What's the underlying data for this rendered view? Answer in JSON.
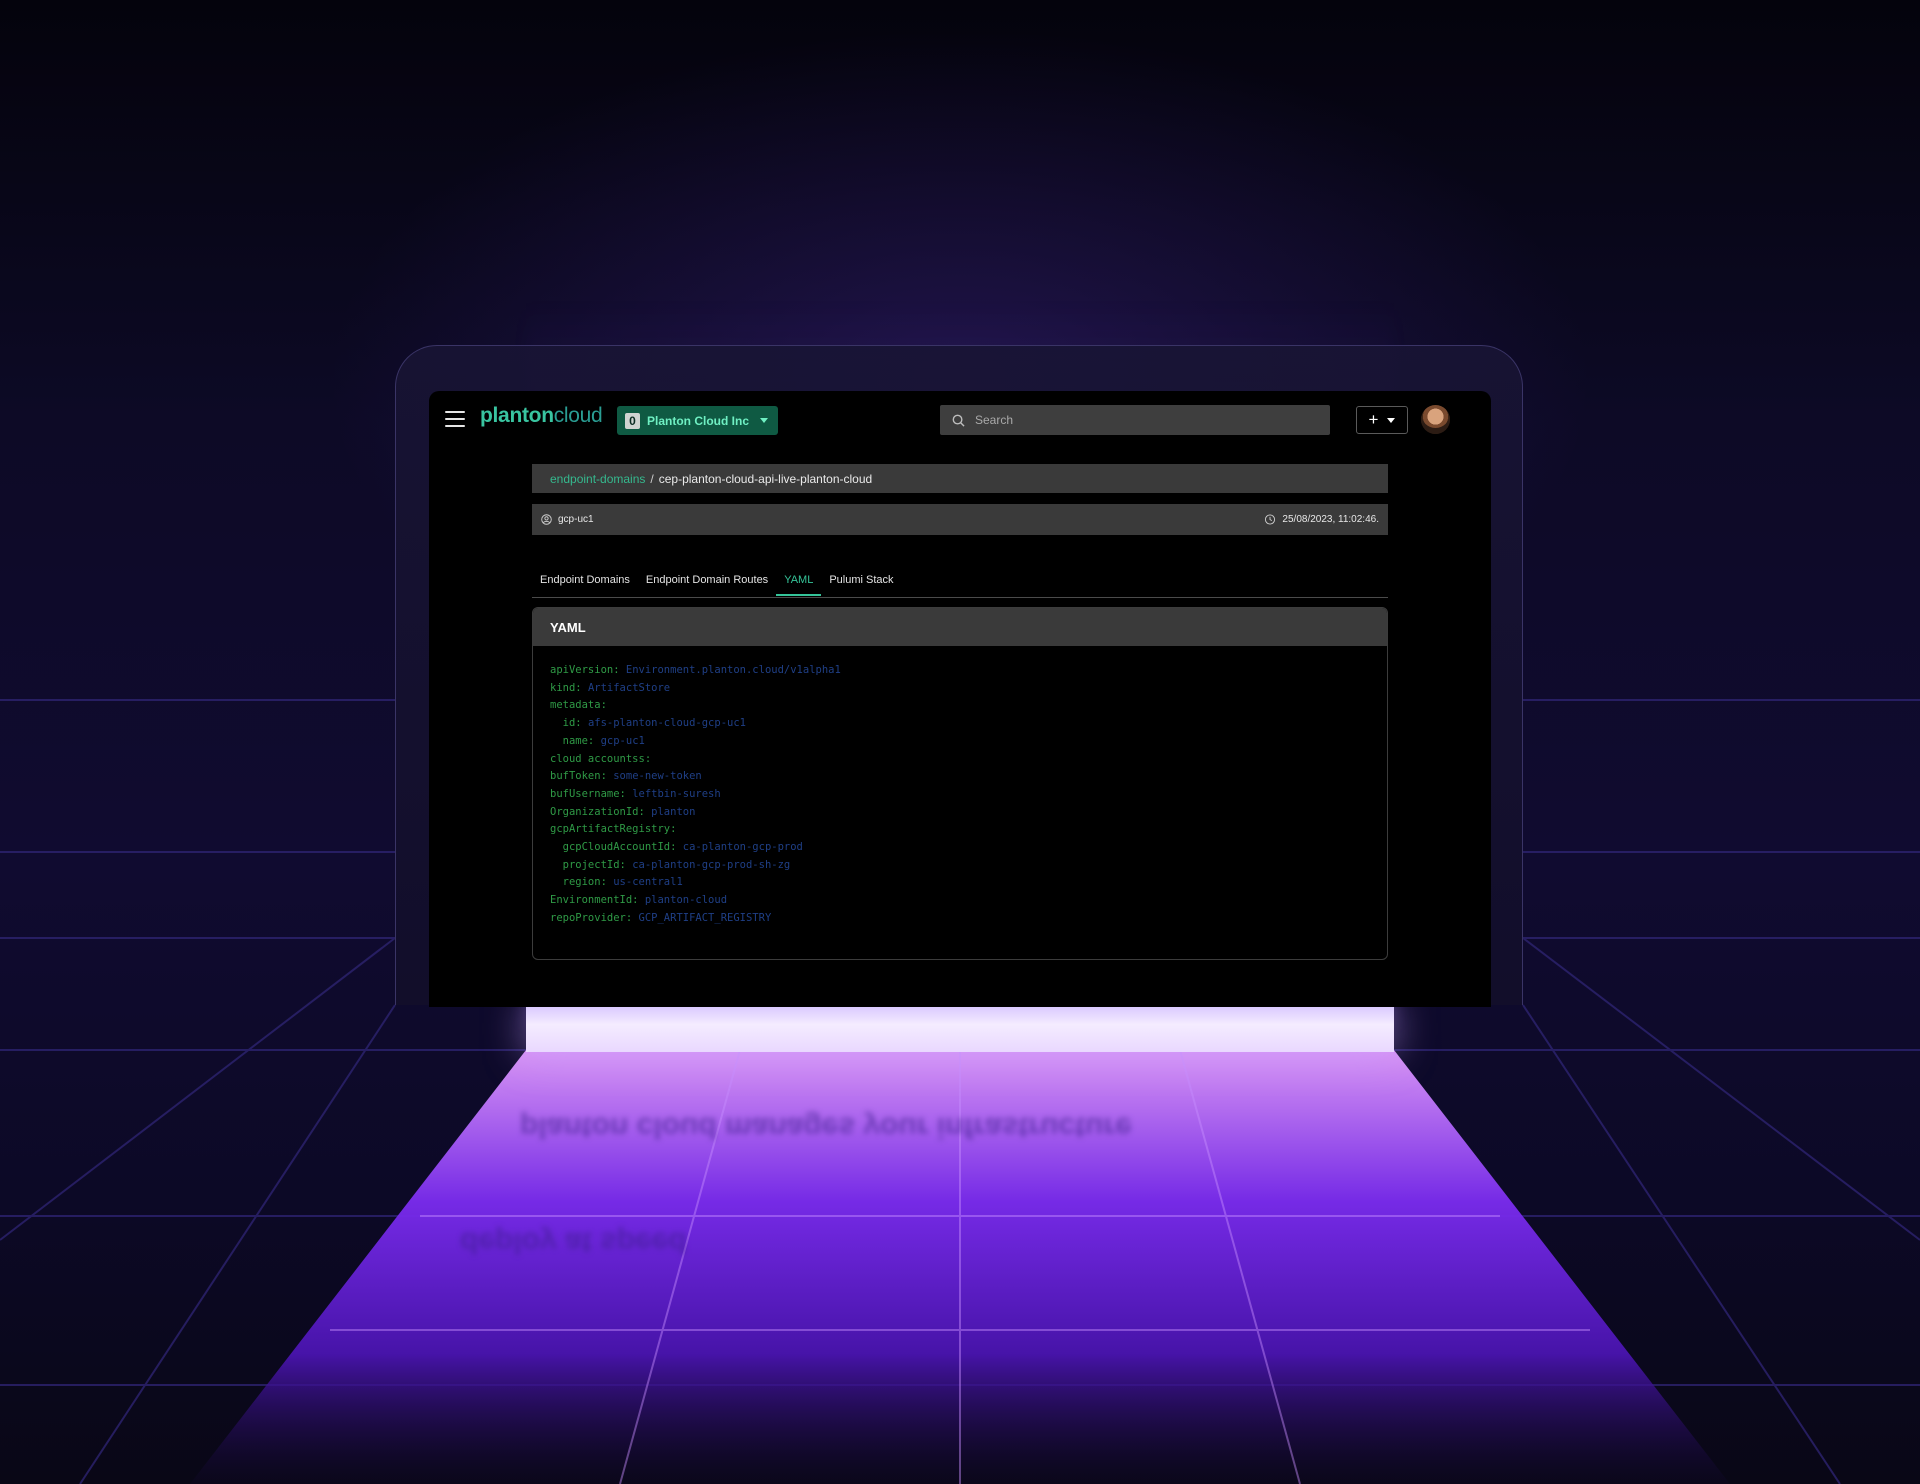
{
  "header": {
    "logo_primary": "planton",
    "logo_secondary": "cloud",
    "org_badge": "0",
    "org_name": "Planton Cloud Inc",
    "search_placeholder": "Search",
    "add_label": "+"
  },
  "breadcrumb": {
    "parent": "endpoint-domains",
    "separator": "/",
    "current": "cep-planton-cloud-api-live-planton-cloud"
  },
  "meta": {
    "environment": "gcp-uc1",
    "timestamp": "25/08/2023, 11:02:46."
  },
  "tabs": [
    {
      "label": "Endpoint Domains",
      "active": false
    },
    {
      "label": "Endpoint Domain Routes",
      "active": false
    },
    {
      "label": "YAML",
      "active": true
    },
    {
      "label": "Pulumi Stack",
      "active": false
    }
  ],
  "yaml": {
    "title": "YAML",
    "lines": [
      {
        "indent": "",
        "key": "apiVersion:",
        "value": "Environment.planton.cloud/v1alpha1"
      },
      {
        "indent": "",
        "key": "kind:",
        "value": "ArtifactStore"
      },
      {
        "indent": "",
        "key": "metadata:",
        "value": ""
      },
      {
        "indent": "  ",
        "key": "id:",
        "value": "afs-planton-cloud-gcp-uc1"
      },
      {
        "indent": "  ",
        "key": "name:",
        "value": "gcp-uc1"
      },
      {
        "indent": "",
        "key": "cloud accountss:",
        "value": ""
      },
      {
        "indent": "",
        "key": "bufToken:",
        "value": "some-new-token"
      },
      {
        "indent": "",
        "key": "bufUsername:",
        "value": "leftbin-suresh"
      },
      {
        "indent": "",
        "key": "OrganizationId:",
        "value": "planton"
      },
      {
        "indent": "",
        "key": "gcpArtifactRegistry:",
        "value": ""
      },
      {
        "indent": "  ",
        "key": "gcpCloudAccountId:",
        "value": "ca-planton-gcp-prod"
      },
      {
        "indent": "  ",
        "key": "projectId:",
        "value": "ca-planton-gcp-prod-sh-zg"
      },
      {
        "indent": "  ",
        "key": "region:",
        "value": "us-central1"
      },
      {
        "indent": "",
        "key": "EnvironmentId:",
        "value": "planton-cloud"
      },
      {
        "indent": "",
        "key": "repoProvider:",
        "value": "GCP_ARTIFACT_REGISTRY"
      }
    ]
  },
  "colors": {
    "accent": "#35c499",
    "org_pill": "#0f5a43",
    "yaml_key": "#2f9a46",
    "yaml_value": "#1f3f86",
    "glow": "#8a3cff"
  },
  "icons": {
    "menu": "menu-icon",
    "search": "search-icon",
    "user": "user-circle-icon",
    "clock": "clock-icon",
    "dropdown": "chevron-down-icon"
  }
}
